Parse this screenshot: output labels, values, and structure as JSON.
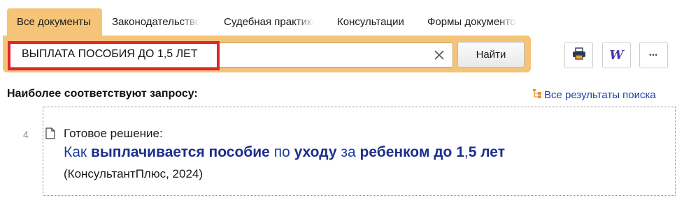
{
  "tabs": [
    {
      "label": "Все документы",
      "active": true
    },
    {
      "label": "Законодательство",
      "active": false
    },
    {
      "label": "Судебная практика",
      "active": false
    },
    {
      "label": "Консультации",
      "active": false
    },
    {
      "label": "Формы документов",
      "active": false
    }
  ],
  "search": {
    "query": "ВЫПЛАТА ПОСОБИЯ ДО 1,5 ЛЕТ",
    "clear_icon": "close-icon",
    "button_label": "Найти"
  },
  "toolbar": {
    "print_icon": "printer-icon",
    "word_icon": "word-export-icon",
    "word_letter": "W",
    "more_icon": "more-icon",
    "more_glyph": "•••"
  },
  "results_header": {
    "heading": "Наиболее соответствуют запросу:",
    "all_results_link": "Все результаты поиска"
  },
  "results": [
    {
      "number": "4",
      "label": "Готовое решение:",
      "title_parts": [
        {
          "text": "Как ",
          "bold": false
        },
        {
          "text": "выплачивается пособие",
          "bold": true
        },
        {
          "text": " по ",
          "bold": false
        },
        {
          "text": "уходу",
          "bold": true
        },
        {
          "text": " за ",
          "bold": false
        },
        {
          "text": "ребенком до 1",
          "bold": true
        },
        {
          "text": ",",
          "bold": false
        },
        {
          "text": "5 лет",
          "bold": true
        }
      ],
      "source": "(КонсультантПлюс, 2024)"
    }
  ],
  "colors": {
    "accent": "#f5c478",
    "highlight": "#e0262b",
    "link": "#1c3f9e"
  }
}
